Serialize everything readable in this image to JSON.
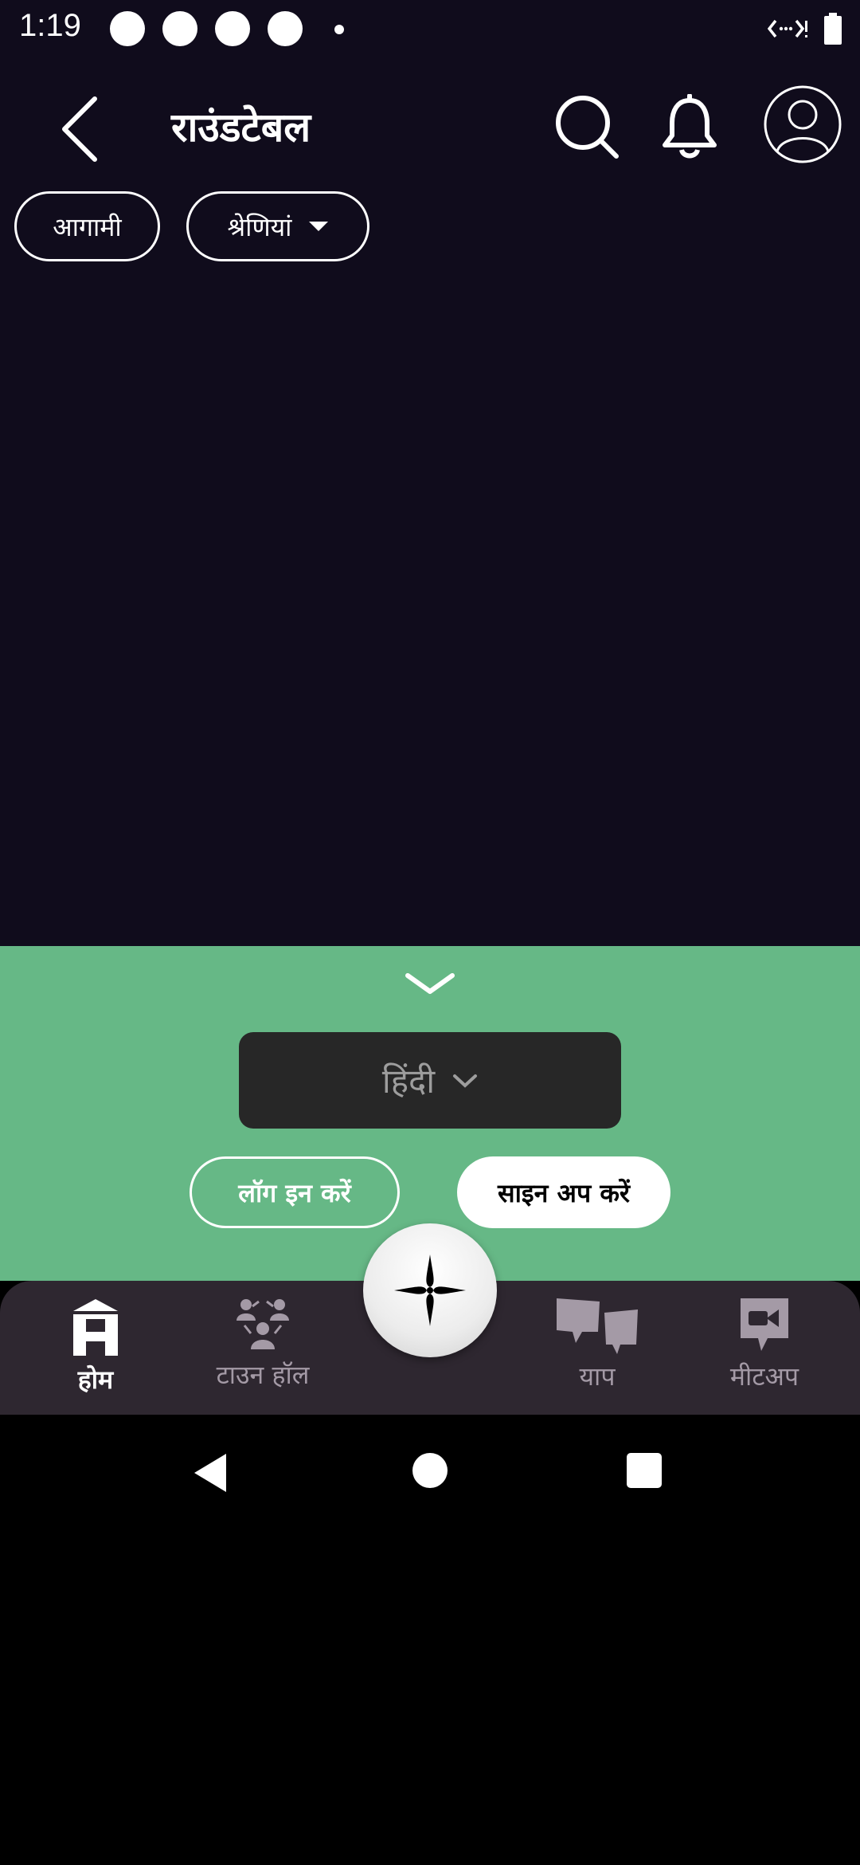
{
  "status_bar": {
    "time": "1:19"
  },
  "header": {
    "title": "राउंडटेबल",
    "back_icon": "chevron-left-icon",
    "search_icon": "search-icon",
    "notifications_icon": "bell-icon",
    "profile_icon": "user-avatar-icon"
  },
  "filters": {
    "upcoming": "आगामी",
    "categories": "श्रेणियां"
  },
  "login_panel": {
    "language": "हिंदी",
    "login_label": "लॉग इन करें",
    "signup_label": "साइन अप करें",
    "background_color": "#66b886"
  },
  "bottom_nav": {
    "items": [
      {
        "label": "होम",
        "icon": "home-icon",
        "active": true
      },
      {
        "label": "टाउन हॉल",
        "icon": "town-hall-icon",
        "active": false
      },
      {
        "label": "याप",
        "icon": "yap-icon",
        "active": false
      },
      {
        "label": "मीटअप",
        "icon": "meetup-icon",
        "active": false
      }
    ],
    "center_icon": "sparkle-icon"
  },
  "colors": {
    "app_background": "#100c1c",
    "nav_background": "#2e2730",
    "language_select_background": "#272727"
  }
}
